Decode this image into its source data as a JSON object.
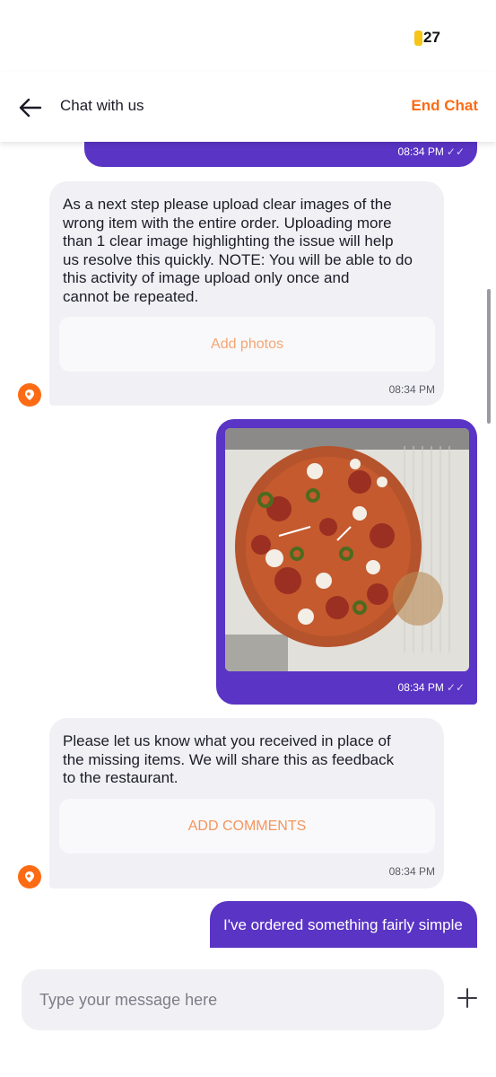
{
  "status": {
    "battery": "27"
  },
  "header": {
    "title": "Chat with us",
    "end_chat": "End Chat"
  },
  "messages": [
    {
      "type": "outgoing",
      "time": "08:34 PM"
    },
    {
      "type": "incoming",
      "text": [
        "As a next step please upload clear images of the",
        "wrong item with the entire order. Uploading more",
        "than 1 clear image highlighting the issue will help",
        "us resolve this quickly. NOTE: You will be able to do",
        "this activity of image upload only once and",
        "cannot be repeated."
      ],
      "button": "Add photos",
      "time": "08:34 PM"
    },
    {
      "type": "outgoing-image",
      "time": "08:34 PM"
    },
    {
      "type": "incoming",
      "text": [
        "Please let us know what you received in place of",
        "the missing items. We will share this as feedback",
        "to the restaurant."
      ],
      "button": "ADD COMMENTS",
      "time": "08:34 PM"
    },
    {
      "type": "outgoing",
      "text": "I've ordered something fairly simple"
    }
  ],
  "composer": {
    "placeholder": "Type your message here"
  },
  "colors": {
    "accent": "#fc6b14",
    "outgoing_bubble": "#5a34c4",
    "incoming_bubble": "#f1f1f5"
  },
  "icons": {
    "back": "arrow-left-icon",
    "double_tick": "double-check-icon",
    "agent": "agent-avatar-icon",
    "plus": "plus-icon"
  }
}
